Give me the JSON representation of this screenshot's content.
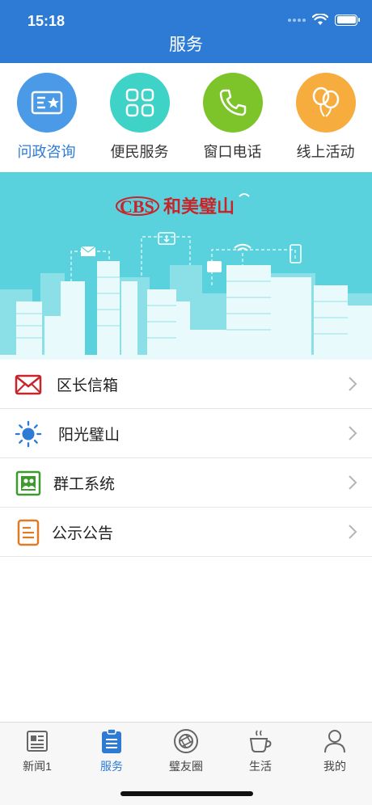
{
  "status": {
    "time": "15:18"
  },
  "header": {
    "title": "服务"
  },
  "quick_services": [
    {
      "label": "问政咨询",
      "icon": "id-card-star-icon",
      "color": "#4a9ae8",
      "active": true
    },
    {
      "label": "便民服务",
      "icon": "grid-icon",
      "color": "#3fd3c8",
      "active": false
    },
    {
      "label": "窗口电话",
      "icon": "phone-icon",
      "color": "#7cc42a",
      "active": false
    },
    {
      "label": "线上活动",
      "icon": "balloons-icon",
      "color": "#f6ad3e",
      "active": false
    }
  ],
  "banner": {
    "logo_left": "CBS",
    "logo_right": "和美璧山",
    "background": "#59d2dd"
  },
  "list": [
    {
      "label": "区长信箱",
      "icon": "envelope-icon",
      "color": "#c8242a"
    },
    {
      "label": "阳光璧山",
      "icon": "sun-icon",
      "color": "#2e7bd6"
    },
    {
      "label": "群工系统",
      "icon": "group-icon",
      "color": "#3d9a2c"
    },
    {
      "label": "公示公告",
      "icon": "notice-icon",
      "color": "#e07a24"
    }
  ],
  "tabbar": [
    {
      "label": "新闻1",
      "icon": "newspaper-icon",
      "active": false
    },
    {
      "label": "服务",
      "icon": "clipboard-icon",
      "active": true
    },
    {
      "label": "璧友圈",
      "icon": "camera-aperture-icon",
      "active": false
    },
    {
      "label": "生活",
      "icon": "coffee-cup-icon",
      "active": false
    },
    {
      "label": "我的",
      "icon": "person-icon",
      "active": false
    }
  ],
  "colors": {
    "primary": "#2e7bd6",
    "tab_inactive": "#666666"
  }
}
